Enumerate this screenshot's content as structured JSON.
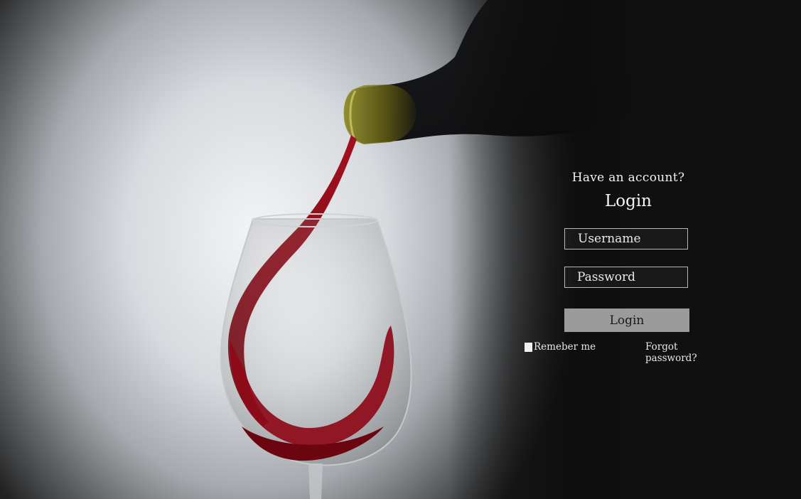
{
  "background": {
    "description_icon": "wine-pour-image",
    "wine_color": "#8e0a18"
  },
  "login": {
    "prompt": "Have an account?",
    "title": "Login",
    "username_placeholder": "Username",
    "password_placeholder": "Password",
    "submit_label": "Login",
    "remember_label": "Remeber me",
    "forgot_label": "Forgot password?",
    "button_color": "#9b9b9b"
  }
}
